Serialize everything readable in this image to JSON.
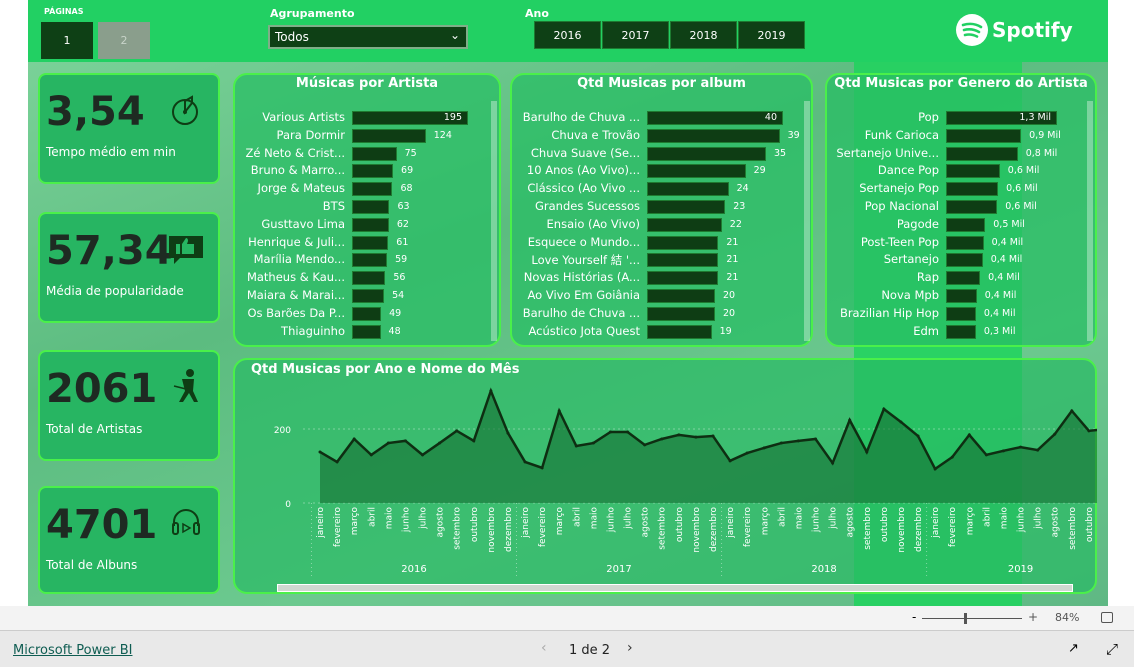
{
  "header": {
    "pages_label": "PÁGINAS",
    "pages": [
      "1",
      "2"
    ],
    "grouping_label": "Agrupamento",
    "grouping_value": "Todos",
    "year_label": "Ano",
    "years": [
      "2016",
      "2017",
      "2018",
      "2019"
    ],
    "logo": "Spotify"
  },
  "kpis": [
    {
      "value": "3,54",
      "label": "Tempo médio em min",
      "icon": "timer-icon"
    },
    {
      "value": "57,34",
      "label": "Média de popularidade",
      "icon": "thumbs-up-icon"
    },
    {
      "value": "2061",
      "label": "Total de Artistas",
      "icon": "guitarist-icon"
    },
    {
      "value": "4701",
      "label": "Total de Albuns",
      "icon": "headphones-icon"
    }
  ],
  "chart_data": [
    {
      "type": "bar",
      "orientation": "horizontal",
      "title": "Músicas por Artista",
      "categories": [
        "Various Artists",
        "Para Dormir",
        "Zé Neto & Crist...",
        "Bruno & Marro...",
        "Jorge & Mateus",
        "BTS",
        "Gusttavo Lima",
        "Henrique & Juli...",
        "Marília Mendo...",
        "Matheus & Kau...",
        "Maiara & Marai...",
        "Os Barões Da P...",
        "Thiaguinho"
      ],
      "values": [
        195,
        124,
        75,
        69,
        68,
        63,
        62,
        61,
        59,
        56,
        54,
        49,
        48
      ],
      "labels": [
        "195",
        "124",
        "75",
        "69",
        "68",
        "63",
        "62",
        "61",
        "59",
        "56",
        "54",
        "49",
        "48"
      ]
    },
    {
      "type": "bar",
      "orientation": "horizontal",
      "title": "Qtd Musicas por album",
      "categories": [
        "Barulho de Chuva ...",
        "Chuva e Trovão",
        "Chuva Suave (Se...",
        "10 Anos (Ao Vivo)...",
        "Clássico (Ao Vivo ...",
        "Grandes Sucessos",
        "Ensaio (Ao Vivo)",
        "Esquece o Mundo...",
        "Love Yourself 結 '...",
        "Novas Histórias (A...",
        "Ao Vivo Em Goiânia",
        "Barulho de Chuva ...",
        "Acústico Jota Quest"
      ],
      "values": [
        40,
        39,
        35,
        29,
        24,
        23,
        22,
        21,
        21,
        21,
        20,
        20,
        19
      ],
      "labels": [
        "40",
        "39",
        "35",
        "29",
        "24",
        "23",
        "22",
        "21",
        "21",
        "21",
        "20",
        "20",
        "19"
      ]
    },
    {
      "type": "bar",
      "orientation": "horizontal",
      "title": "Qtd Musicas por Genero do Artista",
      "categories": [
        "Pop",
        "Funk Carioca",
        "Sertanejo Unive...",
        "Dance Pop",
        "Sertanejo Pop",
        "Pop Nacional",
        "Pagode",
        "Post-Teen Pop",
        "Sertanejo",
        "Rap",
        "Nova Mpb",
        "Brazilian Hip Hop",
        "Edm"
      ],
      "values": [
        1300,
        880,
        840,
        630,
        610,
        600,
        460,
        440,
        430,
        400,
        360,
        350,
        350
      ],
      "labels": [
        "1,3 Mil",
        "0,9 Mil",
        "0,8 Mil",
        "0,6 Mil",
        "0,6 Mil",
        "0,6 Mil",
        "0,5 Mil",
        "0,4 Mil",
        "0,4 Mil",
        "0,4 Mil",
        "0,4 Mil",
        "0,4 Mil",
        "0,3 Mil"
      ]
    },
    {
      "type": "area",
      "title": "Qtd Musicas por Ano e Nome do Mês",
      "yticks": [
        "0",
        "200"
      ],
      "ylim": [
        0,
        330
      ],
      "grid": true,
      "groups": [
        {
          "year": "2016",
          "months": [
            "janeiro",
            "fevereiro",
            "março",
            "abril",
            "maio",
            "junho",
            "julho",
            "agosto",
            "setembro",
            "outubro",
            "novembro",
            "dezembro"
          ],
          "values": [
            138,
            111,
            173,
            130,
            162,
            168,
            130,
            162,
            195,
            168,
            303,
            189
          ]
        },
        {
          "year": "2017",
          "months": [
            "janeiro",
            "fevereiro",
            "março",
            "abril",
            "maio",
            "junho",
            "julho",
            "agosto",
            "setembro",
            "outubro",
            "novembro",
            "dezembro"
          ],
          "values": [
            111,
            95,
            249,
            154,
            162,
            192,
            192,
            157,
            173,
            184,
            178,
            181
          ]
        },
        {
          "year": "2018",
          "months": [
            "janeiro",
            "fevereiro",
            "março",
            "abril",
            "maio",
            "junho",
            "julho",
            "agosto",
            "setembro",
            "outubro",
            "novembro",
            "dezembro"
          ],
          "values": [
            114,
            135,
            149,
            162,
            168,
            173,
            108,
            224,
            138,
            254,
            219,
            181
          ]
        },
        {
          "year": "2019",
          "months": [
            "janeiro",
            "fevereiro",
            "março",
            "abril",
            "maio",
            "junho",
            "julho",
            "agosto",
            "setembro",
            "outubro",
            "novembro"
          ],
          "values": [
            92,
            124,
            184,
            130,
            141,
            151,
            143,
            186,
            249,
            195,
            200
          ]
        }
      ]
    }
  ],
  "footer": {
    "zoom": "84%",
    "zoom_minus": "-",
    "zoom_plus": "+",
    "zoom_level": 0.42,
    "brand": "Microsoft Power BI",
    "page_indicator": "1 de 2"
  },
  "colors": {
    "header": "#22d063",
    "bar": "#0e3d14",
    "card": "#27b562",
    "border": "#4af04a"
  }
}
